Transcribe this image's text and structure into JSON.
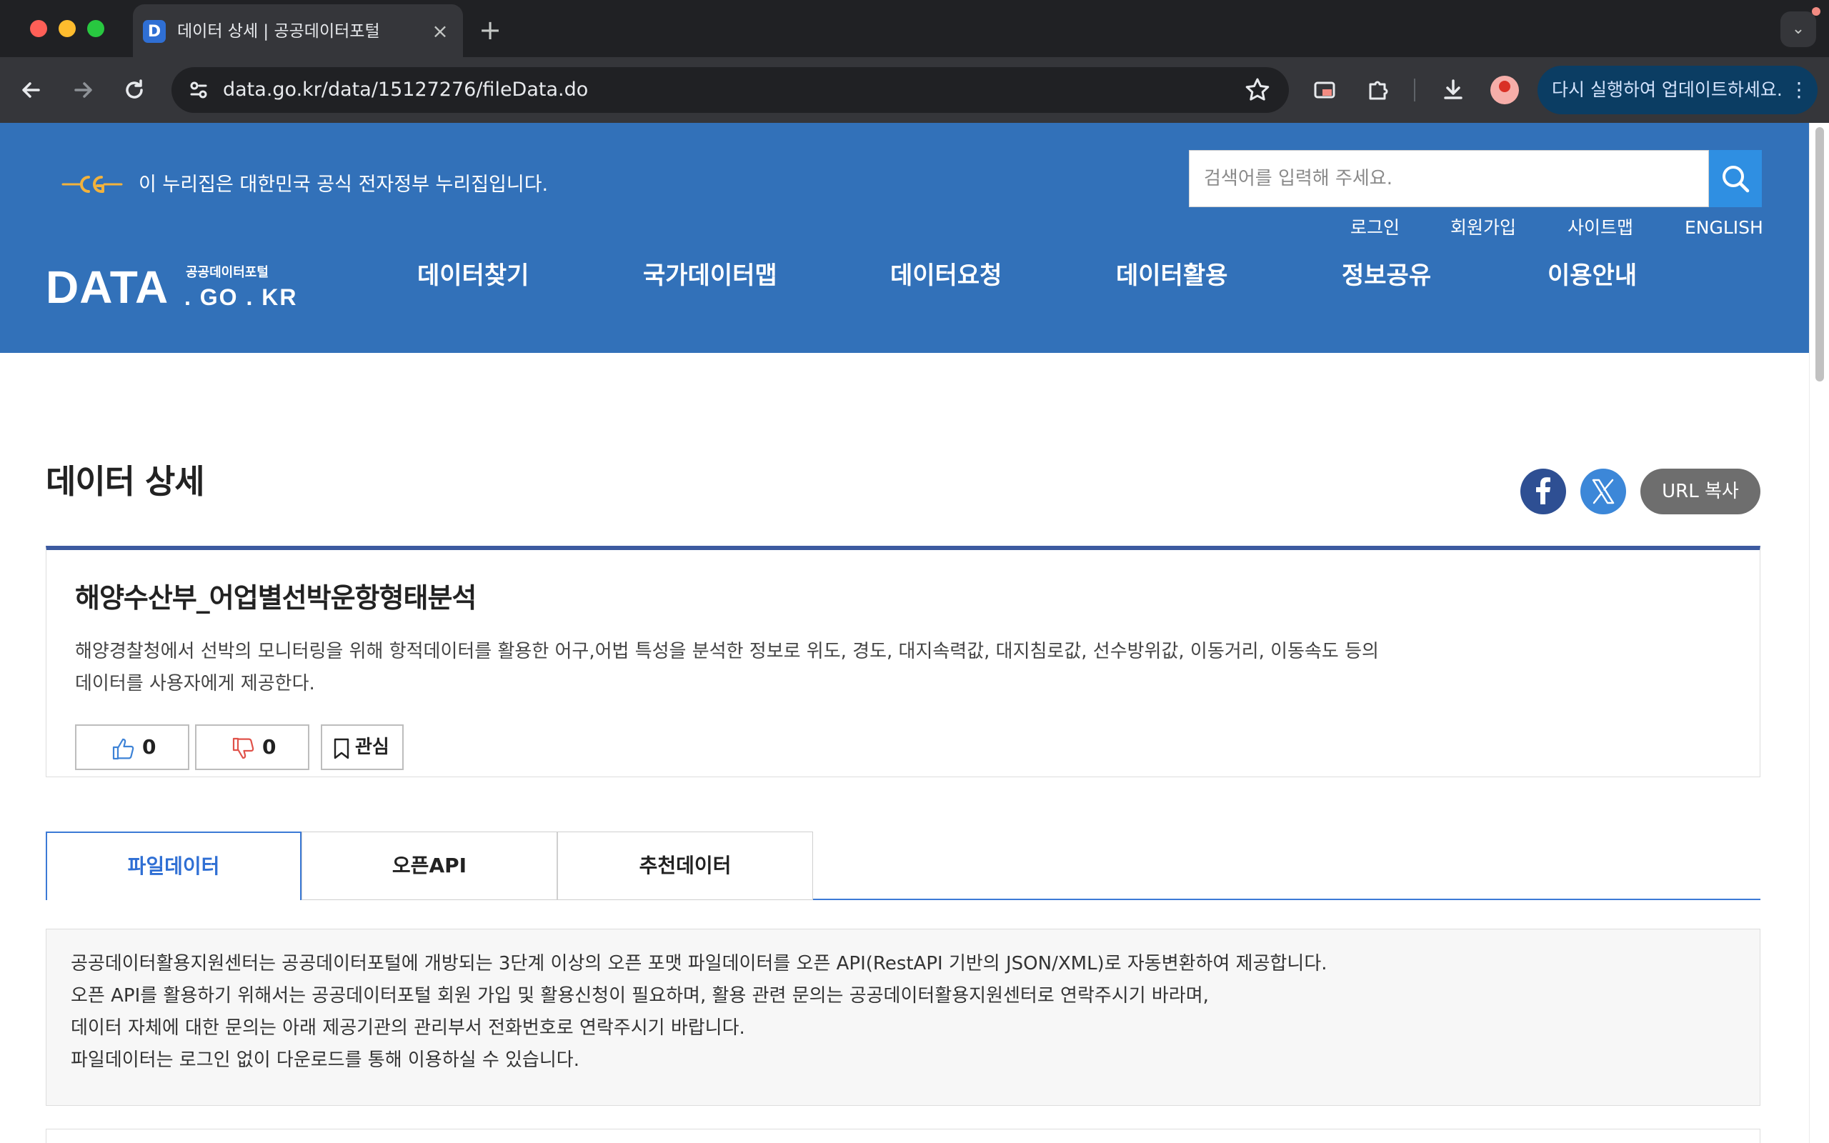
{
  "browser": {
    "tab_title": "데이터 상세 | 공공데이터포털",
    "tab_favicon_letter": "D",
    "tab_close": "×",
    "new_tab": "+",
    "url": "data.go.kr/data/15127276/fileData.do",
    "update_button": "다시 실행하여 업데이트하세요.",
    "icons": {
      "back": "back-arrow-icon",
      "forward": "forward-arrow-icon",
      "reload": "reload-icon",
      "site_info": "tune-icon",
      "bookmark": "star-icon",
      "extension": "puzzle-icon",
      "download": "download-icon",
      "profile": "avatar-icon",
      "menu": "more-vertical-icon"
    }
  },
  "header": {
    "gov_notice": "이 누리집은 대한민국 공식 전자정부 누리집입니다.",
    "search_placeholder": "검색어를 입력해 주세요.",
    "util_links": {
      "login": "로그인",
      "join": "회원가입",
      "sitemap": "사이트맵",
      "english": "ENGLISH"
    },
    "logo": {
      "main": "DATA",
      "sub_kr": "공공데이터포털",
      "sub_en": ". GO . KR"
    },
    "nav": [
      "데이터찾기",
      "국가데이터맵",
      "데이터요청",
      "데이터활용",
      "정보공유",
      "이용안내"
    ]
  },
  "page": {
    "title": "데이터 상세",
    "url_copy": "URL 복사"
  },
  "dataset": {
    "title": "해양수산부_어업별선박운항형태분석",
    "description": "해양경찰청에서 선박의 모니터링을 위해 항적데이터를 활용한 어구,어법 특성을 분석한 정보로 위도, 경도, 대지속력값, 대지침로값, 선수방위값, 이동거리, 이동속도 등의 데이터를 사용자에게 제공한다.",
    "likes": "0",
    "dislikes": "0",
    "favorite_label": "관심"
  },
  "tabs": {
    "file": "파일데이터",
    "api": "오픈API",
    "recommend": "추천데이터"
  },
  "notice": {
    "lines": [
      "공공데이터활용지원센터는 공공데이터포털에 개방되는 3단계 이상의 오픈 포맷 파일데이터를 오픈 API(RestAPI 기반의 JSON/XML)로 자동변환하여 제공합니다.",
      "오픈 API를 활용하기 위해서는 공공데이터포털 회원 가입 및 활용신청이 필요하며, 활용 관련 문의는 공공데이터활용지원센터로 연락주시기 바라며,",
      "데이터 자체에 대한 문의는 아래 제공기관의 관리부서 전화번호로 연락주시기 바랍니다.",
      "파일데이터는 로그인 없이 다운로드를 통해 이용하실 수 있습니다."
    ]
  },
  "colors": {
    "header_blue": "#3271b9",
    "search_button": "#2f8fe2",
    "active_tab": "#2f6fd4",
    "card_top_border": "#3c5aa0",
    "facebook": "#2e4f93",
    "x_share": "#3c87d8"
  }
}
